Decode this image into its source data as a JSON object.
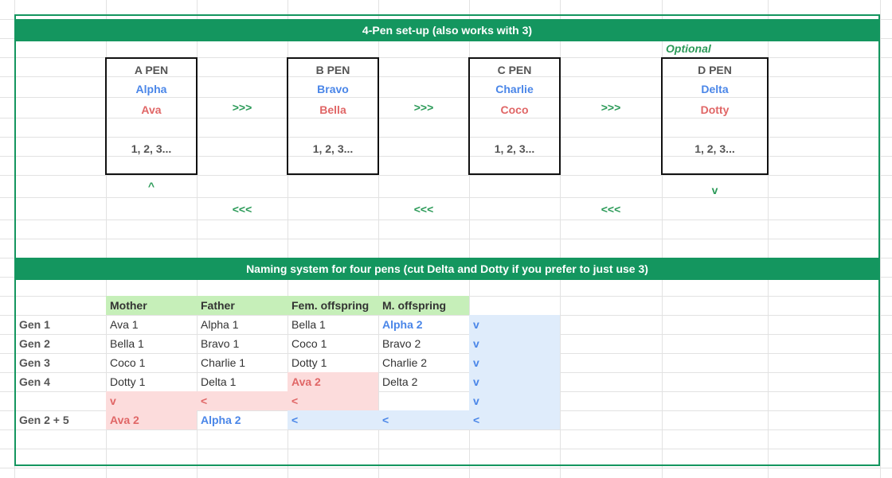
{
  "setup": {
    "banner": "4-Pen set-up (also works with 3)",
    "optional_label": "Optional",
    "pens": [
      {
        "title": "A PEN",
        "male": "Alpha",
        "female": "Ava",
        "numbers": "1, 2, 3..."
      },
      {
        "title": "B PEN",
        "male": "Bravo",
        "female": "Bella",
        "numbers": "1, 2, 3..."
      },
      {
        "title": "C PEN",
        "male": "Charlie",
        "female": "Coco",
        "numbers": "1, 2, 3..."
      },
      {
        "title": "D PEN",
        "male": "Delta",
        "female": "Dotty",
        "numbers": "1, 2, 3..."
      }
    ],
    "forward_arrow": ">>>",
    "back_arrow": "<<<",
    "up_arrow": "^",
    "down_arrow": "v"
  },
  "naming": {
    "banner": "Naming system for four pens (cut Delta and Dotty if you prefer to just use 3)",
    "headers": [
      "Mother",
      "Father",
      "Fem. offspring",
      "M. offspring"
    ],
    "rows": [
      {
        "gen": "Gen 1",
        "cells": [
          "Ava 1",
          "Alpha 1",
          "Bella 1",
          "Alpha 2",
          "v"
        ]
      },
      {
        "gen": "Gen 2",
        "cells": [
          "Bella 1",
          "Bravo 1",
          "Coco 1",
          "Bravo 2",
          "v"
        ]
      },
      {
        "gen": "Gen 3",
        "cells": [
          "Coco 1",
          "Charlie 1",
          "Dotty 1",
          "Charlie 2",
          "v"
        ]
      },
      {
        "gen": "Gen 4",
        "cells": [
          "Dotty 1",
          "Delta 1",
          "Ava 2",
          "Delta 2",
          "v"
        ]
      },
      {
        "gen": "",
        "cells": [
          "v",
          "<",
          "<",
          "",
          "v"
        ]
      },
      {
        "gen": "Gen 2 + 5",
        "cells": [
          "Ava 2",
          "Alpha 2",
          "<",
          "<",
          "<"
        ]
      }
    ]
  },
  "colors": {
    "banner_green": "#14965f",
    "male_blue": "#4a86e8",
    "female_red": "#e06666",
    "header_green": "#c6efb9",
    "loop_pink": "#fcdcdc",
    "loop_blue": "#dfecfb"
  }
}
